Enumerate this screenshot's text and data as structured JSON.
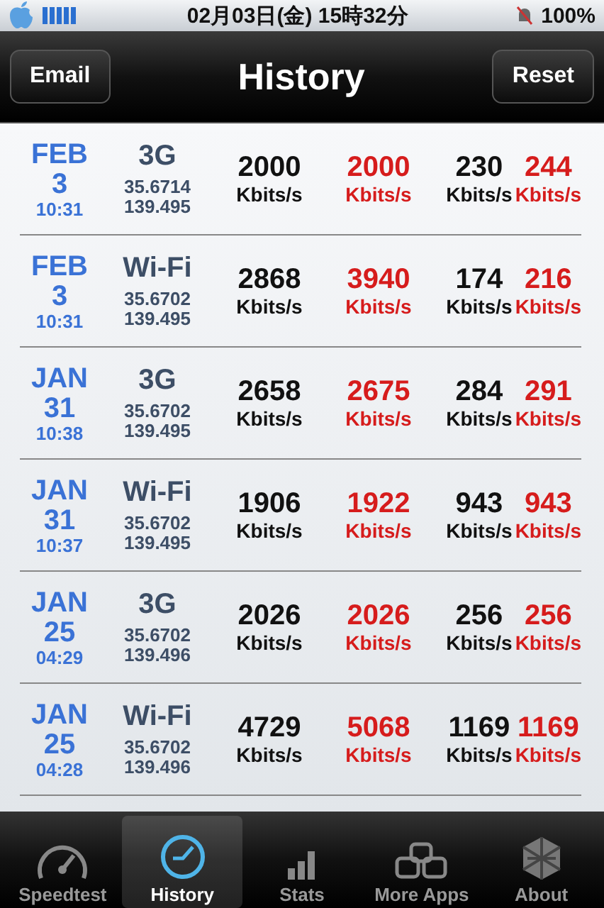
{
  "status_bar": {
    "datetime": "02月03日(金)  15時32分",
    "battery": "100%"
  },
  "nav": {
    "title": "History",
    "left_button": "Email",
    "right_button": "Reset"
  },
  "rows": [
    {
      "month": "FEB",
      "day": "3",
      "time": "10:31",
      "network": "3G",
      "lat": "35.6714",
      "lon": "139.495",
      "down_a": "2000",
      "down_b": "2000",
      "up_a": "230",
      "up_b": "244",
      "unit_1": "Kbits/s",
      "unit_2": "Kbits/s",
      "unit_3": "Kbits/s",
      "unit_4": "Kbits/s"
    },
    {
      "month": "FEB",
      "day": "3",
      "time": "10:31",
      "network": "Wi-Fi",
      "lat": "35.6702",
      "lon": "139.495",
      "down_a": "2868",
      "down_b": "3940",
      "up_a": "174",
      "up_b": "216",
      "unit_1": "Kbits/s",
      "unit_2": "Kbits/s",
      "unit_3": "Kbits/s",
      "unit_4": "Kbits/s"
    },
    {
      "month": "JAN",
      "day": "31",
      "time": "10:38",
      "network": "3G",
      "lat": "35.6702",
      "lon": "139.495",
      "down_a": "2658",
      "down_b": "2675",
      "up_a": "284",
      "up_b": "291",
      "unit_1": "Kbits/s",
      "unit_2": "Kbits/s",
      "unit_3": "Kbits/s",
      "unit_4": "Kbits/s"
    },
    {
      "month": "JAN",
      "day": "31",
      "time": "10:37",
      "network": "Wi-Fi",
      "lat": "35.6702",
      "lon": "139.495",
      "down_a": "1906",
      "down_b": "1922",
      "up_a": "943",
      "up_b": "943",
      "unit_1": "Kbits/s",
      "unit_2": "Kbits/s",
      "unit_3": "Kbits/s",
      "unit_4": "Kbits/s"
    },
    {
      "month": "JAN",
      "day": "25",
      "time": "04:29",
      "network": "3G",
      "lat": "35.6702",
      "lon": "139.496",
      "down_a": "2026",
      "down_b": "2026",
      "up_a": "256",
      "up_b": "256",
      "unit_1": "Kbits/s",
      "unit_2": "Kbits/s",
      "unit_3": "Kbits/s",
      "unit_4": "Kbits/s"
    },
    {
      "month": "JAN",
      "day": "25",
      "time": "04:28",
      "network": "Wi-Fi",
      "lat": "35.6702",
      "lon": "139.496",
      "down_a": "4729",
      "down_b": "5068",
      "up_a": "1169",
      "up_b": "1169",
      "unit_1": "Kbits/s",
      "unit_2": "Kbits/s",
      "unit_3": "Kbits/s",
      "unit_4": "Kbits/s"
    }
  ],
  "tabs": [
    {
      "label": "Speedtest",
      "kind": "gauge",
      "selected": false
    },
    {
      "label": "History",
      "kind": "clock",
      "selected": true
    },
    {
      "label": "Stats",
      "kind": "bars",
      "selected": false
    },
    {
      "label": "More Apps",
      "kind": "boxes",
      "selected": false
    },
    {
      "label": "About",
      "kind": "globe",
      "selected": false
    }
  ]
}
